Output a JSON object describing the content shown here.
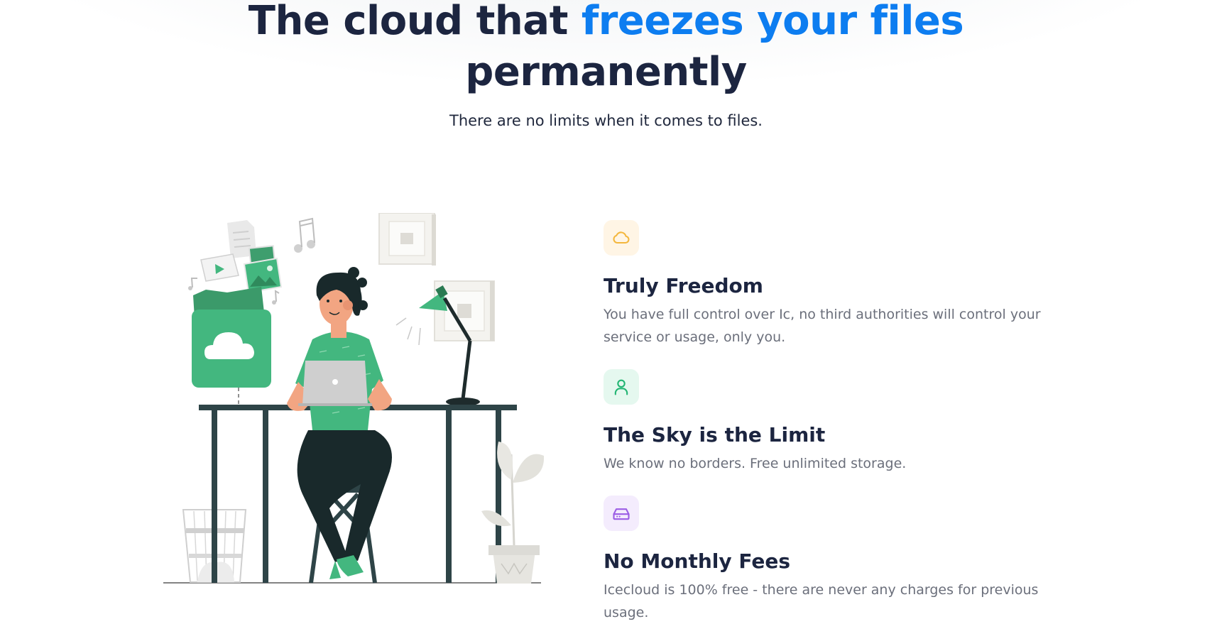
{
  "hero": {
    "title_part1": "The cloud that ",
    "title_accent": "freezes your files",
    "title_part2": "permanently",
    "subtitle": "There are no limits when it comes to files."
  },
  "illustration": {
    "icon": "person-at-desk-with-cloud-illustration"
  },
  "features": [
    {
      "icon": "cloud-icon",
      "icon_color": "#f4b73d",
      "icon_bg": "#fff5e5",
      "title": "Truly Freedom",
      "text": "You have full control over Ic, no third authorities will control your service or usage, only you."
    },
    {
      "icon": "user-icon",
      "icon_color": "#22b573",
      "icon_bg": "#e5f8ef",
      "title": "The Sky is the Limit",
      "text": "We know no borders. Free unlimited storage."
    },
    {
      "icon": "hard-drive-icon",
      "icon_color": "#9b5de5",
      "icon_bg": "#f4ecfd",
      "title": "No Monthly Fees",
      "text": "Icecloud is 100% free - there are never any charges for previous usage."
    }
  ],
  "colors": {
    "accent": "#0d7df0",
    "heading": "#1c2540",
    "body_text": "#6b6f7b",
    "illustration_green": "#43b77f"
  }
}
